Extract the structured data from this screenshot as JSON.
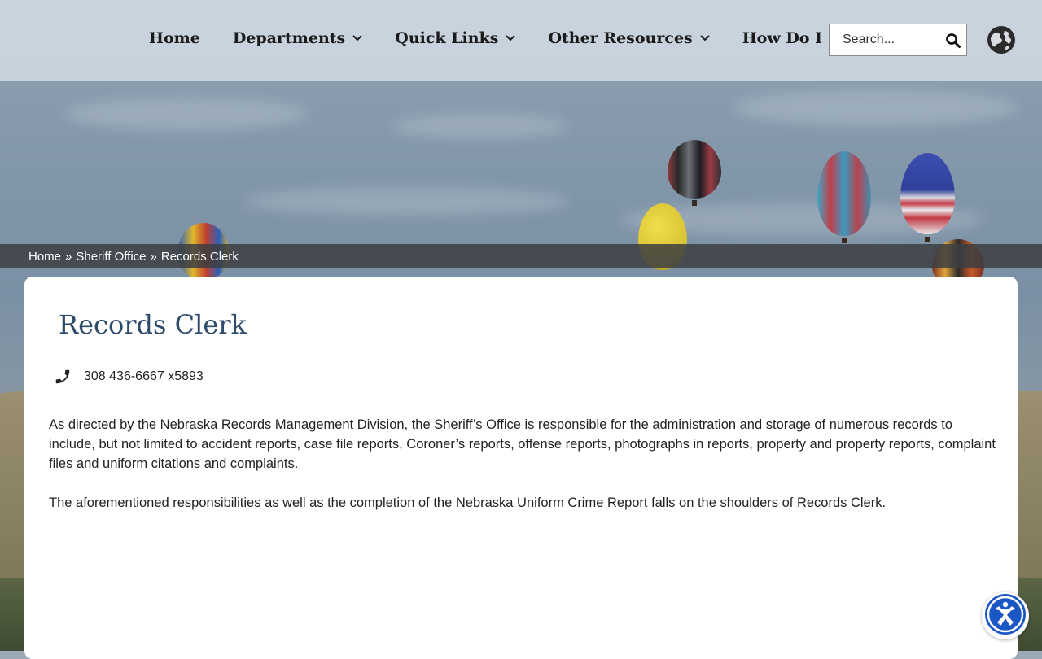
{
  "nav": {
    "items": [
      {
        "label": "Home",
        "has_dropdown": false
      },
      {
        "label": "Departments",
        "has_dropdown": true
      },
      {
        "label": "Quick Links",
        "has_dropdown": true
      },
      {
        "label": "Other Resources",
        "has_dropdown": true
      },
      {
        "label": "How Do I",
        "has_dropdown": true
      }
    ]
  },
  "search": {
    "placeholder": "Search..."
  },
  "icons": {
    "search": "search-icon",
    "language": "globe-icon",
    "phone": "phone-icon",
    "accessibility": "accessibility-icon",
    "dropdown": "chevron-down-icon"
  },
  "breadcrumb": {
    "items": [
      "Home",
      "Sheriff Office",
      "Records Clerk"
    ],
    "separator": "»"
  },
  "page": {
    "title": "Records Clerk",
    "phone": "308 436-6667 x5893",
    "paragraphs": [
      "As directed by the Nebraska Records Management Division, the Sheriff’s Office is  responsible for the administration and storage of numerous records to include, but not limited to accident reports, case file reports, Coroner’s reports, offense reports, photographs in reports, property and property reports, complaint files and uniform citations and complaints.",
      "The aforementioned responsibilities as well as the completion of the Nebraska Uniform Crime Report falls on the shoulders of Records Clerk."
    ]
  },
  "colors": {
    "title": "#2e4b6a",
    "accessibility": "#1a56c4",
    "breadcrumb_bg": "#3c3e42"
  }
}
